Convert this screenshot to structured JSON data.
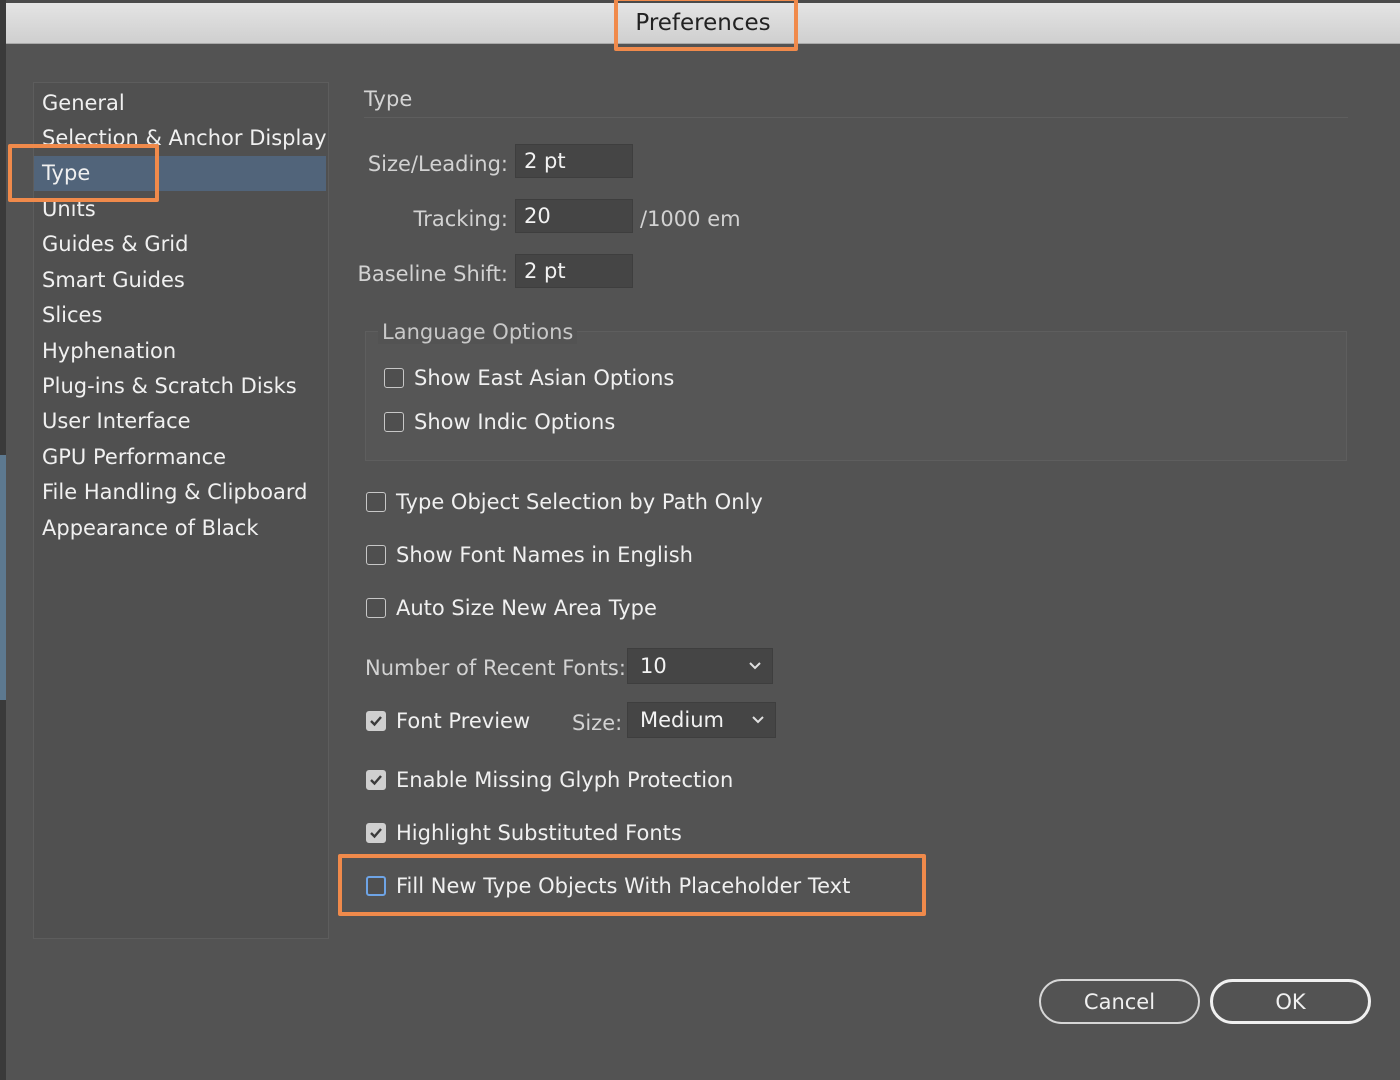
{
  "window": {
    "title": "Preferences"
  },
  "sidebar": {
    "items": [
      {
        "label": "General",
        "selected": false
      },
      {
        "label": "Selection & Anchor Display",
        "selected": false
      },
      {
        "label": "Type",
        "selected": true
      },
      {
        "label": "Units",
        "selected": false
      },
      {
        "label": "Guides & Grid",
        "selected": false
      },
      {
        "label": "Smart Guides",
        "selected": false
      },
      {
        "label": "Slices",
        "selected": false
      },
      {
        "label": "Hyphenation",
        "selected": false
      },
      {
        "label": "Plug-ins & Scratch Disks",
        "selected": false
      },
      {
        "label": "User Interface",
        "selected": false
      },
      {
        "label": "GPU Performance",
        "selected": false
      },
      {
        "label": "File Handling & Clipboard",
        "selected": false
      },
      {
        "label": "Appearance of Black",
        "selected": false
      }
    ]
  },
  "type_panel": {
    "section_title": "Type",
    "size_leading": {
      "label": "Size/Leading:",
      "value": "2 pt"
    },
    "tracking": {
      "label": "Tracking:",
      "value": "20",
      "unit": "/1000 em"
    },
    "baseline_shift": {
      "label": "Baseline Shift:",
      "value": "2 pt"
    },
    "language_options": {
      "title": "Language Options",
      "show_east_asian": {
        "label": "Show East Asian Options",
        "checked": false
      },
      "show_indic": {
        "label": "Show Indic Options",
        "checked": false
      }
    },
    "type_object_selection": {
      "label": "Type Object Selection by Path Only",
      "checked": false
    },
    "show_font_names_english": {
      "label": "Show Font Names in English",
      "checked": false
    },
    "auto_size_area_type": {
      "label": "Auto Size New Area Type",
      "checked": false
    },
    "recent_fonts": {
      "label": "Number of Recent Fonts:",
      "value": "10"
    },
    "font_preview": {
      "label": "Font Preview",
      "checked": true,
      "size_label": "Size:",
      "size_value": "Medium"
    },
    "missing_glyph": {
      "label": "Enable Missing Glyph Protection",
      "checked": true
    },
    "highlight_substituted": {
      "label": "Highlight Substituted Fonts",
      "checked": true
    },
    "fill_placeholder": {
      "label": "Fill New Type Objects With Placeholder Text",
      "checked": false
    }
  },
  "buttons": {
    "cancel": "Cancel",
    "ok": "OK"
  },
  "colors": {
    "highlight": "#f08a4b",
    "selection": "#51647a",
    "focus": "#6ea4e6"
  },
  "icons": {
    "check": "checkmark-icon",
    "dropdown": "chevron-down-icon"
  }
}
